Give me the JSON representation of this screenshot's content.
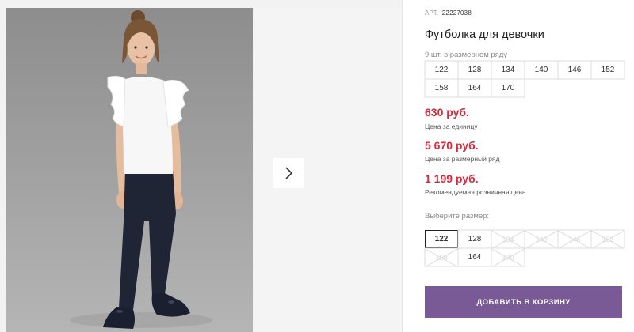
{
  "product": {
    "article_label": "АРТ.",
    "article_number": "22227038",
    "title": "Футболка для девочки"
  },
  "pack": {
    "label": "9 шт. в размерном ряду",
    "sizes": [
      "122",
      "128",
      "134",
      "140",
      "146",
      "152",
      "158",
      "164",
      "170"
    ]
  },
  "prices": {
    "unit_price": "630 руб.",
    "unit_label": "Цена за единицу",
    "pack_price": "5 670 руб.",
    "pack_label": "Цена за размерный ряд",
    "retail_price": "1 199 руб.",
    "retail_label": "Рекомендуемая розничная цена",
    "accent_color": "#d32a3c"
  },
  "size_selector": {
    "label": "Выберите размер:",
    "selected": "122",
    "options": [
      {
        "size": "122",
        "available": true
      },
      {
        "size": "128",
        "available": true
      },
      {
        "size": "134",
        "available": false
      },
      {
        "size": "140",
        "available": false
      },
      {
        "size": "146",
        "available": false
      },
      {
        "size": "152",
        "available": false
      },
      {
        "size": "158",
        "available": false
      },
      {
        "size": "164",
        "available": true
      },
      {
        "size": "170",
        "available": false
      }
    ]
  },
  "cart_button": {
    "label": "ДОБАВИТЬ В КОРЗИНУ",
    "color": "#7a5a96"
  },
  "gallery": {
    "next_icon": "chevron-right-icon"
  }
}
